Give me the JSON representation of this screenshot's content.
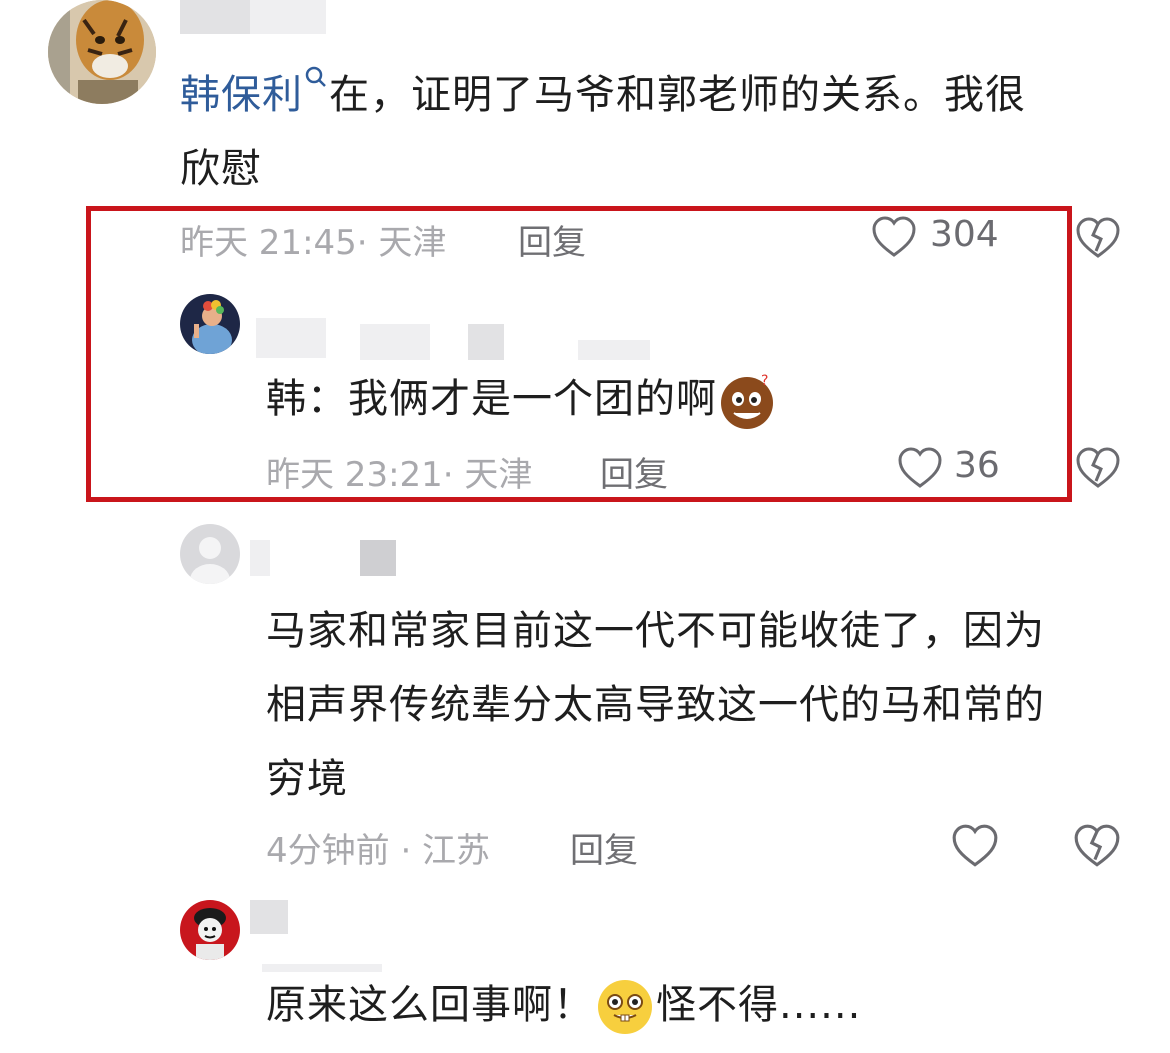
{
  "comments": [
    {
      "mention": "韩保利",
      "text_lines": [
        "在，证明了马爷和郭老师的关系。我很",
        "欣慰"
      ],
      "time": "昨天 21:45· 天津",
      "reply_label": "回复",
      "likes": "304"
    },
    {
      "text": "韩：我俩才是一个团的啊",
      "time": "昨天 23:21· 天津",
      "reply_label": "回复",
      "likes": "36"
    },
    {
      "text_lines": [
        "马家和常家目前这一代不可能收徒了，因为",
        "相声界传统辈分太高导致这一代的马和常的",
        "穷境"
      ],
      "time": "4分钟前 · 江苏",
      "reply_label": "回复",
      "likes": ""
    },
    {
      "text_before_emoji": "原来这么回事啊！",
      "text_after_emoji": "怪不得......"
    }
  ],
  "colors": {
    "highlight_border": "#c9151b",
    "mention": "#2f5c9a",
    "meta_text": "#a9a9ad"
  },
  "icons": [
    "heart-icon",
    "broken-heart-icon",
    "search-icon",
    "emoji-sweat-icon",
    "emoji-grin-icon"
  ]
}
